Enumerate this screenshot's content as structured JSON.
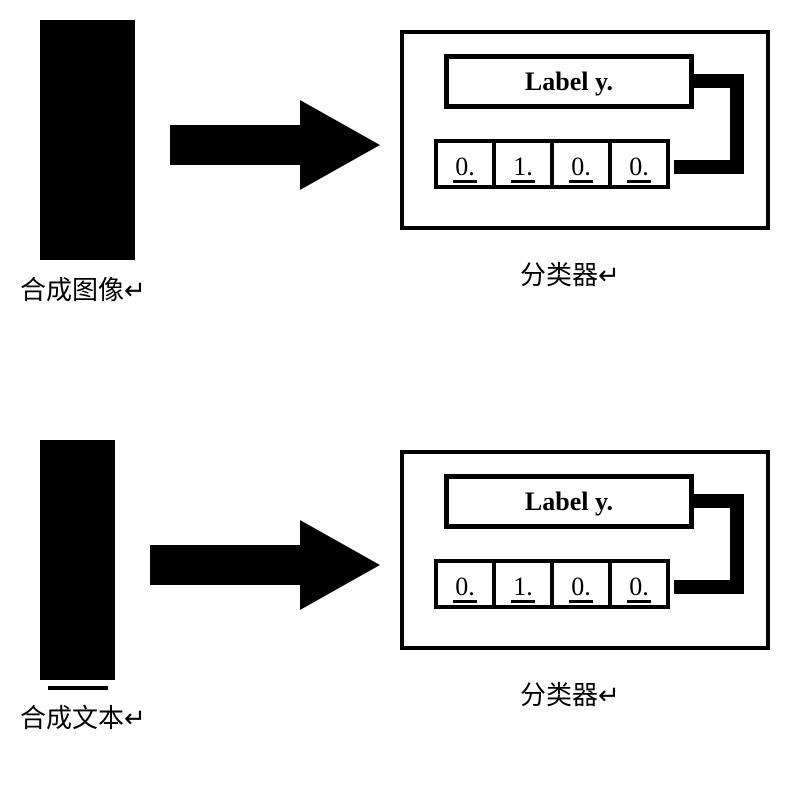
{
  "row1": {
    "input_label": "合成图像↵",
    "classifier_label": "分类器↵",
    "label_box": "Label y.",
    "digits": [
      "0.",
      "1.",
      "0.",
      "0."
    ]
  },
  "row2": {
    "input_label": "合成文本↵",
    "classifier_label": "分类器↵",
    "label_box": "Label y.",
    "digits": [
      "0.",
      "1.",
      "0.",
      "0."
    ]
  }
}
